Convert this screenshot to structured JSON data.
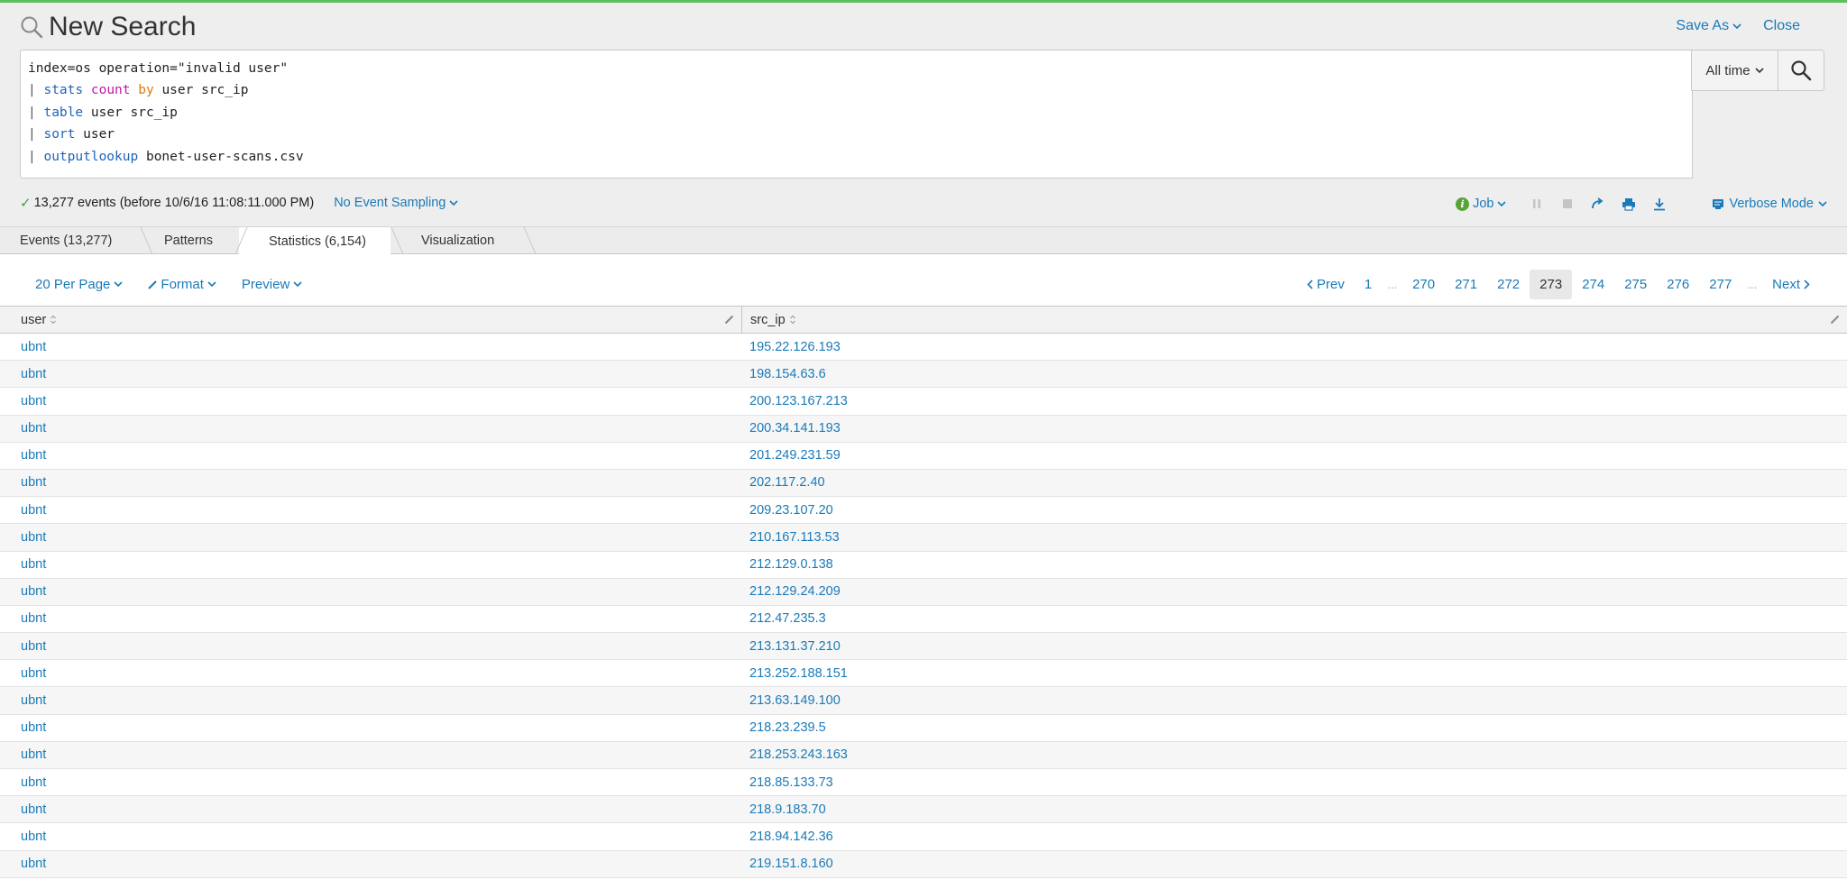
{
  "header": {
    "title": "New Search",
    "save_as": "Save As",
    "close": "Close"
  },
  "search": {
    "lines": [
      {
        "parts": [
          {
            "t": "index=os operation=\"invalid user\"",
            "c": ""
          }
        ]
      },
      {
        "parts": [
          {
            "t": "| ",
            "c": "pipe"
          },
          {
            "t": "stats",
            "c": "kw-cmd"
          },
          {
            "t": " ",
            "c": ""
          },
          {
            "t": "count",
            "c": "kw-fn"
          },
          {
            "t": " ",
            "c": ""
          },
          {
            "t": "by",
            "c": "kw-by"
          },
          {
            "t": " user src_ip",
            "c": ""
          }
        ]
      },
      {
        "parts": [
          {
            "t": "| ",
            "c": "pipe"
          },
          {
            "t": "table",
            "c": "kw-cmd"
          },
          {
            "t": " user src_ip",
            "c": ""
          }
        ]
      },
      {
        "parts": [
          {
            "t": "| ",
            "c": "pipe"
          },
          {
            "t": "sort",
            "c": "kw-cmd"
          },
          {
            "t": " user",
            "c": ""
          }
        ]
      },
      {
        "parts": [
          {
            "t": "| ",
            "c": "pipe"
          },
          {
            "t": "outputlookup",
            "c": "kw-cmd"
          },
          {
            "t": " bonet-user-scans.csv",
            "c": ""
          }
        ]
      }
    ],
    "time_range": "All time"
  },
  "status": {
    "events": "13,277 events (before 10/6/16 11:08:11.000 PM)",
    "sampling": "No Event Sampling",
    "job": "Job",
    "mode": "Verbose Mode"
  },
  "tabs": [
    {
      "label": "Events (13,277)"
    },
    {
      "label": "Patterns"
    },
    {
      "label": "Statistics (6,154)"
    },
    {
      "label": "Visualization"
    }
  ],
  "toolbar": {
    "per_page": "20 Per Page",
    "format": "Format",
    "preview": "Preview"
  },
  "pager": {
    "prev": "Prev",
    "next": "Next",
    "first": "1",
    "ellipsis": "...",
    "pages": [
      "270",
      "271",
      "272",
      "273",
      "274",
      "275",
      "276",
      "277"
    ],
    "current": "273"
  },
  "table": {
    "columns": [
      "user",
      "src_ip"
    ],
    "rows": [
      [
        "ubnt",
        "195.22.126.193"
      ],
      [
        "ubnt",
        "198.154.63.6"
      ],
      [
        "ubnt",
        "200.123.167.213"
      ],
      [
        "ubnt",
        "200.34.141.193"
      ],
      [
        "ubnt",
        "201.249.231.59"
      ],
      [
        "ubnt",
        "202.117.2.40"
      ],
      [
        "ubnt",
        "209.23.107.20"
      ],
      [
        "ubnt",
        "210.167.113.53"
      ],
      [
        "ubnt",
        "212.129.0.138"
      ],
      [
        "ubnt",
        "212.129.24.209"
      ],
      [
        "ubnt",
        "212.47.235.3"
      ],
      [
        "ubnt",
        "213.131.37.210"
      ],
      [
        "ubnt",
        "213.252.188.151"
      ],
      [
        "ubnt",
        "213.63.149.100"
      ],
      [
        "ubnt",
        "218.23.239.5"
      ],
      [
        "ubnt",
        "218.253.243.163"
      ],
      [
        "ubnt",
        "218.85.133.73"
      ],
      [
        "ubnt",
        "218.9.183.70"
      ],
      [
        "ubnt",
        "218.94.142.36"
      ],
      [
        "ubnt",
        "219.151.8.160"
      ]
    ]
  },
  "colors": {
    "accent": "#5cc05c",
    "link": "#1a7ab8"
  }
}
